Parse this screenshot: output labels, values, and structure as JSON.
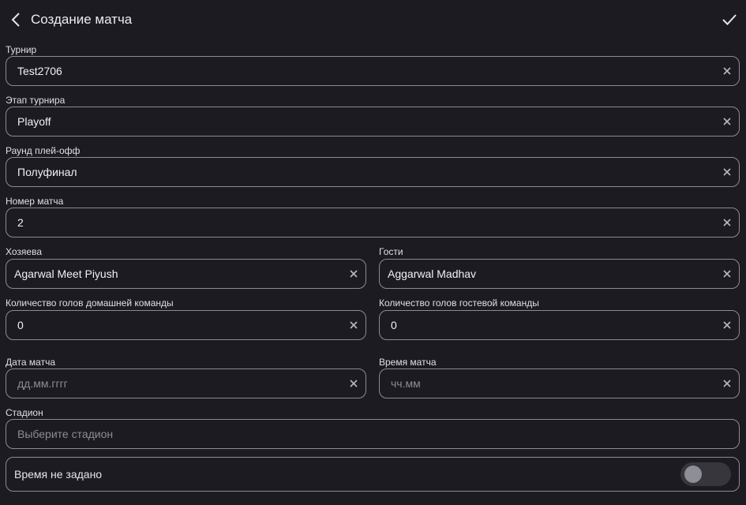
{
  "appbar": {
    "title": "Создание матча",
    "back_icon": "chevron-left-icon",
    "confirm_icon": "check-icon"
  },
  "fields": {
    "tournament": {
      "label": "Турнир",
      "value": "Test2706"
    },
    "stage": {
      "label": "Этап турнира",
      "value": "Playoff"
    },
    "round": {
      "label": "Раунд плей-офф",
      "value": "Полуфинал"
    },
    "match_number": {
      "label": "Номер матча",
      "value": "2"
    },
    "home": {
      "label": "Хозяева",
      "value": "Agarwal Meet Piyush"
    },
    "guests": {
      "label": "Гости",
      "value": "Aggarwal Madhav"
    },
    "home_goals": {
      "label": "Количество голов домашней команды",
      "value": "0"
    },
    "guest_goals": {
      "label": "Количество голов гостевой команды",
      "value": "0"
    },
    "match_date": {
      "label": "Дата матча",
      "placeholder": "дд.мм.гггг"
    },
    "match_time": {
      "label": "Время матча",
      "placeholder": "чч.мм"
    },
    "stadium": {
      "label": "Стадион",
      "placeholder": "Выберите стадион"
    }
  },
  "time_not_set": {
    "label": "Время не задано",
    "checked": false
  },
  "colors": {
    "background": "#1c1b21",
    "border": "#8c8a93",
    "text": "#f1f0f5",
    "placeholder": "#8d8b95"
  }
}
